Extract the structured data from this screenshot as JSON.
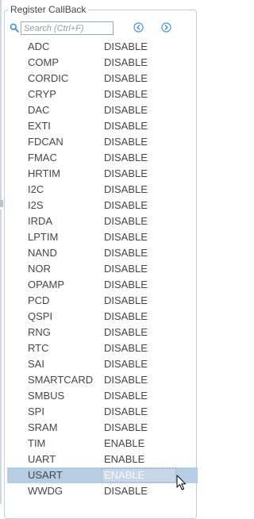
{
  "group": {
    "title": "Register CallBack"
  },
  "search": {
    "placeholder": "Search (Ctrl+F)",
    "value": ""
  },
  "colors": {
    "accent": "#3c8ddb",
    "selected_row": "#b7cde3",
    "text": "#464646"
  },
  "icons": {
    "search": "search-icon",
    "prev": "chevron-left-circle-icon",
    "next": "chevron-right-circle-icon",
    "cursor": "mouse-pointer-icon"
  },
  "rows": [
    {
      "name": "ADC",
      "value": "DISABLE"
    },
    {
      "name": "COMP",
      "value": "DISABLE"
    },
    {
      "name": "CORDIC",
      "value": "DISABLE"
    },
    {
      "name": "CRYP",
      "value": "DISABLE"
    },
    {
      "name": "DAC",
      "value": "DISABLE"
    },
    {
      "name": "EXTI",
      "value": "DISABLE"
    },
    {
      "name": "FDCAN",
      "value": "DISABLE"
    },
    {
      "name": "FMAC",
      "value": "DISABLE"
    },
    {
      "name": "HRTIM",
      "value": "DISABLE"
    },
    {
      "name": "I2C",
      "value": "DISABLE"
    },
    {
      "name": "I2S",
      "value": "DISABLE"
    },
    {
      "name": "IRDA",
      "value": "DISABLE"
    },
    {
      "name": "LPTIM",
      "value": "DISABLE"
    },
    {
      "name": "NAND",
      "value": "DISABLE"
    },
    {
      "name": "NOR",
      "value": "DISABLE"
    },
    {
      "name": "OPAMP",
      "value": "DISABLE"
    },
    {
      "name": "PCD",
      "value": "DISABLE"
    },
    {
      "name": "QSPI",
      "value": "DISABLE"
    },
    {
      "name": "RNG",
      "value": "DISABLE"
    },
    {
      "name": "RTC",
      "value": "DISABLE"
    },
    {
      "name": "SAI",
      "value": "DISABLE"
    },
    {
      "name": "SMARTCARD",
      "value": "DISABLE"
    },
    {
      "name": "SMBUS",
      "value": "DISABLE"
    },
    {
      "name": "SPI",
      "value": "DISABLE"
    },
    {
      "name": "SRAM",
      "value": "DISABLE"
    },
    {
      "name": "TIM",
      "value": "ENABLE"
    },
    {
      "name": "UART",
      "value": "ENABLE"
    },
    {
      "name": "USART",
      "value": "ENABLE",
      "selected": true
    },
    {
      "name": "WWDG",
      "value": "DISABLE"
    }
  ]
}
